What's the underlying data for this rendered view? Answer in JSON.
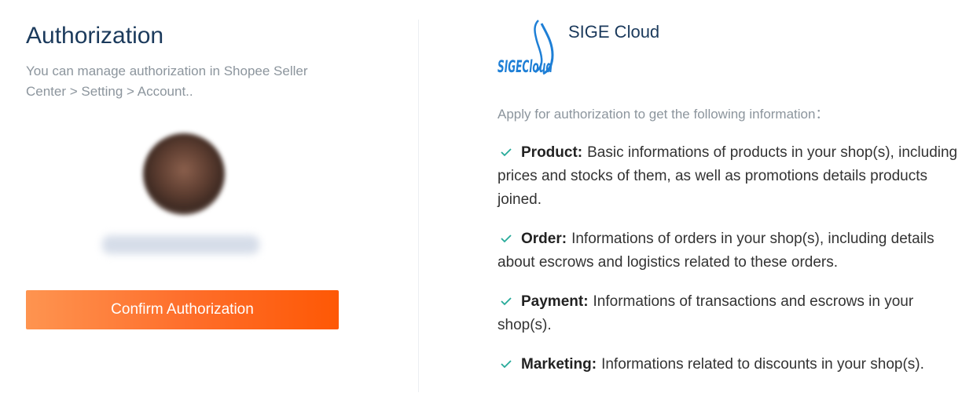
{
  "left": {
    "title": "Authorization",
    "subtitle": "You can manage authorization in Shopee Seller Center > Setting > Account..",
    "confirm_label": "Confirm Authorization"
  },
  "right": {
    "app_name": "SIGE Cloud",
    "logo_text": "SIGECloud",
    "apply_text": "Apply for authorization to get the following information：",
    "permissions": [
      {
        "name": "Product",
        "desc": "Basic informations of products in your shop(s), including prices and stocks of them, as well as promotions details products joined."
      },
      {
        "name": "Order",
        "desc": "Informations of orders in your shop(s), including details about escrows and logistics related to these orders."
      },
      {
        "name": "Payment",
        "desc": "Informations of transactions and escrows in your shop(s)."
      },
      {
        "name": "Marketing",
        "desc": "Informations related to discounts in your shop(s)."
      }
    ]
  },
  "colors": {
    "accent_orange_start": "#fe9450",
    "accent_orange_end": "#fe5805",
    "title_navy": "#1b3a5c",
    "check_green": "#26aa99",
    "muted_gray": "#8c959d",
    "logo_blue": "#1e7fd6"
  },
  "icons": {
    "check": "check-icon",
    "logo": "sige-cloud-logo"
  }
}
